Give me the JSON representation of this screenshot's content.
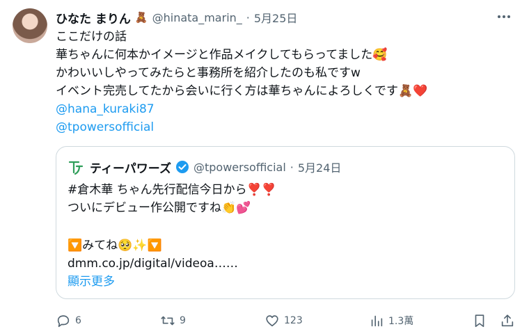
{
  "author": {
    "display_name": "ひなた まりん",
    "name_emoji": "🧸",
    "handle": "@hinata_marin_",
    "separator": "·",
    "date": "5月25日"
  },
  "tweet": {
    "lines": [
      "ここだけの話",
      "華ちゃんに何本かイメージと作品メイクしてもらってました🥰",
      "かわいいしやってみたらと事務所を紹介したのも私ですw",
      "イベント完売してたから会いに行く方は華ちゃんによろしくです🧸❤️"
    ],
    "mentions": [
      "@hana_kuraki87",
      "@tpowersofficial"
    ]
  },
  "quoted": {
    "display_name": "ティーパワーズ",
    "handle": "@tpowersofficial",
    "separator": "·",
    "date": "5月24日",
    "lines": [
      "#倉木華 ちゃん先行配信今日から❣️❣️",
      "ついにデビュー作公開ですね👏💕",
      "",
      "🔽みてね🥺✨🔽",
      "dmm.co.jp/digital/videoa……"
    ],
    "show_more": "顯示更多"
  },
  "actions": {
    "replies": "6",
    "retweets": "9",
    "likes": "123",
    "views": "1.3萬"
  },
  "icons": [
    "more-icon",
    "reply-icon",
    "retweet-icon",
    "like-icon",
    "views-icon",
    "bookmark-icon",
    "share-icon",
    "verified-icon"
  ],
  "colors": {
    "link": "#1d9bf0",
    "muted": "#536471",
    "text": "#0f1419",
    "border": "#cfd9de"
  }
}
